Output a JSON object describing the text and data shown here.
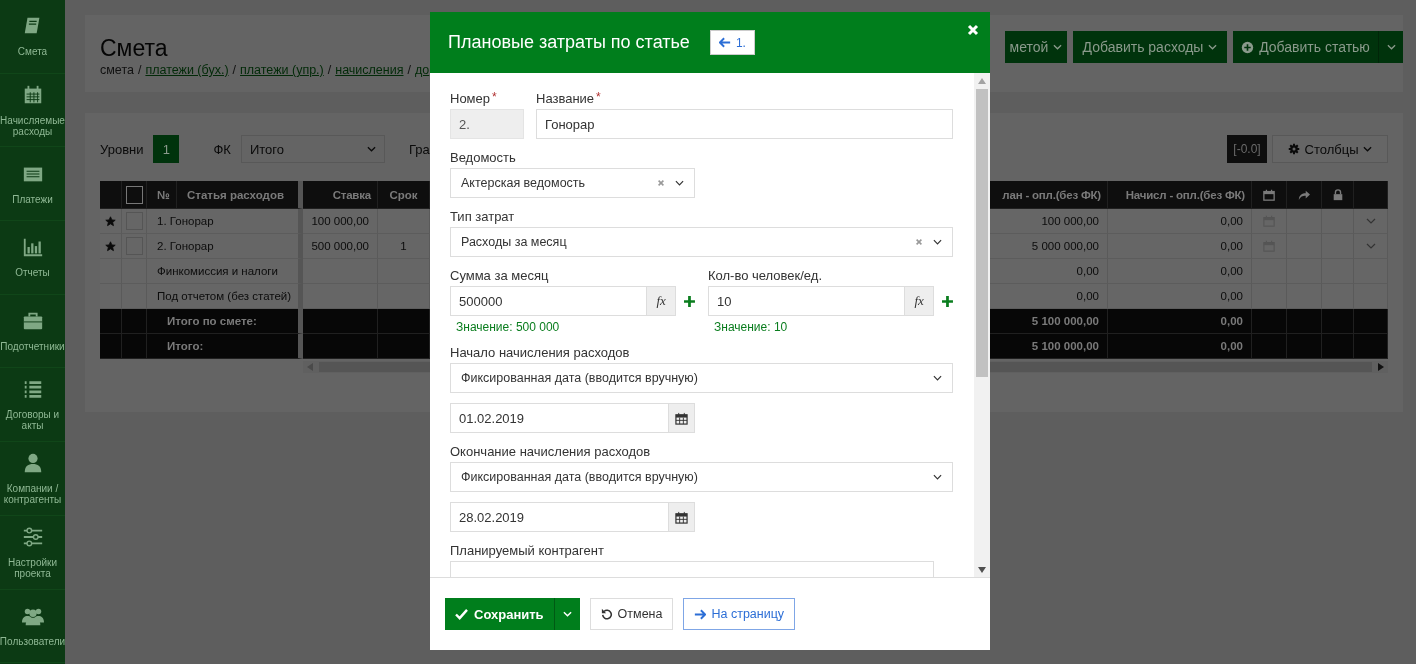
{
  "sidebar": {
    "items": [
      {
        "label": "Смета"
      },
      {
        "label": "Начисляемые расходы"
      },
      {
        "label": "Платежи"
      },
      {
        "label": "Отчеты"
      },
      {
        "label": "Подотчетники"
      },
      {
        "label": "Договоры и акты"
      },
      {
        "label": "Компании / контрагенты"
      },
      {
        "label": "Настройки проекта"
      },
      {
        "label": "Пользователи"
      }
    ]
  },
  "page": {
    "title": "Смета",
    "breadcrumb_separator": "/",
    "breadcrumb": [
      {
        "text": "смета",
        "link": false
      },
      {
        "text": "платежи (бух.)",
        "link": true
      },
      {
        "text": "платежи (упр.)",
        "link": true
      },
      {
        "text": "начисления",
        "link": true
      },
      {
        "text": "до",
        "link": true
      }
    ],
    "toolbar_buttons": [
      {
        "label": "метой",
        "kind": "dropdown"
      },
      {
        "label": "Добавить расходы",
        "kind": "dropdown"
      },
      {
        "label": "Добавить статью",
        "kind": "split"
      }
    ],
    "levels": {
      "label": "Уровни",
      "value": "1"
    },
    "fk": {
      "label": "ФК",
      "value": "Итого"
    },
    "cut_label": "Гра",
    "rounding": "[-0.0]",
    "columns_button": "Столбцы"
  },
  "table": {
    "header_checked": false,
    "columns": [
      "№",
      "Статья расходов",
      "Ставка",
      "Срок",
      "лан - опл.(без ФК)",
      "Начисл - опл.(без ФК)"
    ],
    "rows": [
      {
        "kind": "item",
        "starred": true,
        "checked": false,
        "name": "1. Гонорар",
        "rate": "100 000,00",
        "term": "",
        "plan": "100 000,00",
        "accrued": "0,00"
      },
      {
        "kind": "item",
        "starred": true,
        "checked": false,
        "name": "2. Гонорар",
        "rate": "500 000,00",
        "term": "1",
        "plan": "5 000 000,00",
        "accrued": "0,00"
      },
      {
        "kind": "extra",
        "name": "Финкомиссия и налоги",
        "rate": "",
        "term": "",
        "plan": "0,00",
        "accrued": "0,00"
      },
      {
        "kind": "extra",
        "name": "Под отчетом (без статей)",
        "rate": "",
        "term": "",
        "plan": "0,00",
        "accrued": "0,00"
      }
    ],
    "totals": [
      {
        "label": "Итого по смете:",
        "plan": "5 100 000,00",
        "accrued": "0,00"
      },
      {
        "label": "Итого:",
        "plan": "5 100 000,00",
        "accrued": "0,00"
      }
    ]
  },
  "modal": {
    "title": "Плановые затраты по статье",
    "back_button": "1.",
    "number": {
      "label": "Номер",
      "required_mark": "*",
      "value": "2.",
      "disabled": true
    },
    "name": {
      "label": "Название",
      "required_mark": "*",
      "value": "Гонорар"
    },
    "statement": {
      "label": "Ведомость",
      "value": "Актерская ведомость",
      "clearable": true
    },
    "cost_type": {
      "label": "Тип затрат",
      "value": "Расходы за месяц",
      "clearable": true
    },
    "monthly_sum": {
      "label": "Сумма за месяц",
      "value": "500000",
      "formula_button": "fx",
      "hint": "Значение: 500 000"
    },
    "quantity": {
      "label": "Кол-во человек/ед.",
      "value": "10",
      "formula_button": "fx",
      "hint": "Значение: 10"
    },
    "start": {
      "label": "Начало начисления расходов",
      "mode": "Фиксированная дата (вводится вручную)",
      "date": "01.02.2019"
    },
    "end": {
      "label": "Окончание начисления расходов",
      "mode": "Фиксированная дата (вводится вручную)",
      "date": "28.02.2019"
    },
    "contractor": {
      "label": "Планируемый контрагент"
    },
    "footer": {
      "save": "Сохранить",
      "cancel": "Отмена",
      "to_page": "На страницу"
    }
  }
}
